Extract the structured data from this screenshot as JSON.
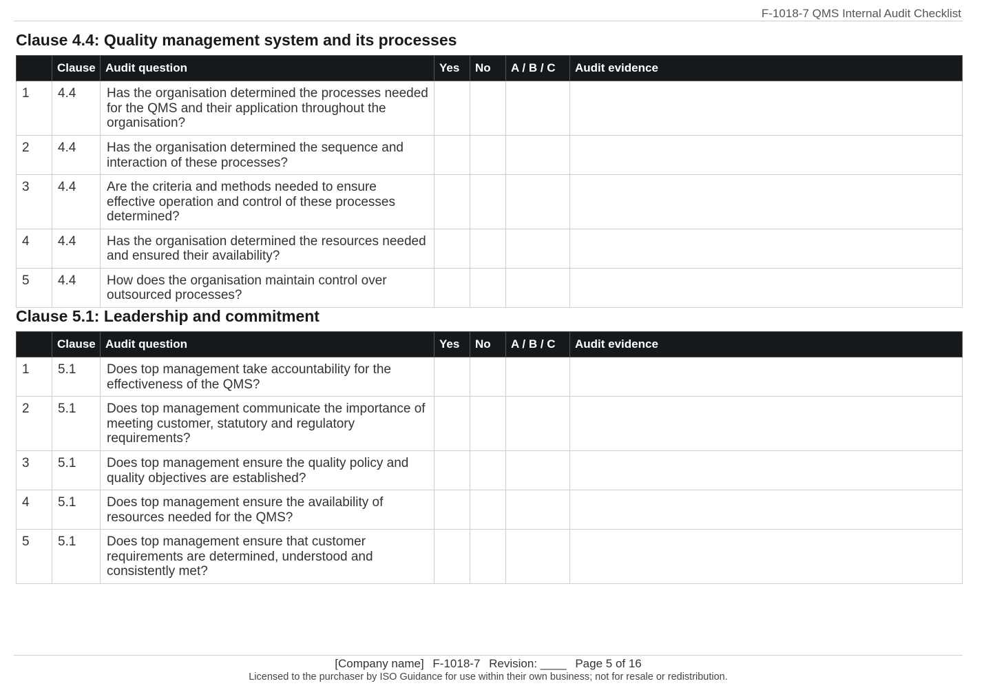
{
  "header": {
    "doc_ref": "F-1018-7  QMS Internal Audit Checklist"
  },
  "columns": [
    "",
    "Clause",
    "Audit question",
    "Yes",
    "No",
    "A / B / C",
    "Audit evidence"
  ],
  "sections": [
    {
      "title": "Clause 4.4: Quality management system and its processes",
      "rows": [
        {
          "num": "1",
          "clause": "4.4",
          "question": "Has the organisation determined the processes needed for the QMS and their application throughout the organisation?",
          "yes": "",
          "no": "",
          "abc": "",
          "evidence": ""
        },
        {
          "num": "2",
          "clause": "4.4",
          "question": "Has the organisation determined the sequence and interaction of these processes?",
          "yes": "",
          "no": "",
          "abc": "",
          "evidence": ""
        },
        {
          "num": "3",
          "clause": "4.4",
          "question": "Are the criteria and methods needed to ensure effective operation and control of these processes determined?",
          "yes": "",
          "no": "",
          "abc": "",
          "evidence": ""
        },
        {
          "num": "4",
          "clause": "4.4",
          "question": "Has the organisation determined the resources needed and ensured their availability?",
          "yes": "",
          "no": "",
          "abc": "",
          "evidence": ""
        },
        {
          "num": "5",
          "clause": "4.4",
          "question": "How does the organisation maintain control over outsourced processes?",
          "yes": "",
          "no": "",
          "abc": "",
          "evidence": ""
        }
      ]
    },
    {
      "title": "Clause 5.1: Leadership and commitment",
      "rows": [
        {
          "num": "1",
          "clause": "5.1",
          "question": "Does top management take accountability for the effectiveness of the QMS?",
          "yes": "",
          "no": "",
          "abc": "",
          "evidence": ""
        },
        {
          "num": "2",
          "clause": "5.1",
          "question": "Does top management communicate the importance of meeting customer, statutory and regulatory requirements?",
          "yes": "",
          "no": "",
          "abc": "",
          "evidence": ""
        },
        {
          "num": "3",
          "clause": "5.1",
          "question": "Does top management ensure the quality policy and quality objectives are established?",
          "yes": "",
          "no": "",
          "abc": "",
          "evidence": ""
        },
        {
          "num": "4",
          "clause": "5.1",
          "question": "Does top management ensure the availability of resources needed for the QMS?",
          "yes": "",
          "no": "",
          "abc": "",
          "evidence": ""
        },
        {
          "num": "5",
          "clause": "5.1",
          "question": "Does top management ensure that customer requirements are determined, understood and consistently met?",
          "yes": "",
          "no": "",
          "abc": "",
          "evidence": ""
        }
      ]
    }
  ],
  "footer": {
    "company": "[Company name]",
    "doc_no": "F-1018-7",
    "revision": "Revision: ____",
    "page": "Page 5 of 16",
    "license": "Licensed to the purchaser by ISO Guidance for use within their own business; not for resale or redistribution."
  }
}
